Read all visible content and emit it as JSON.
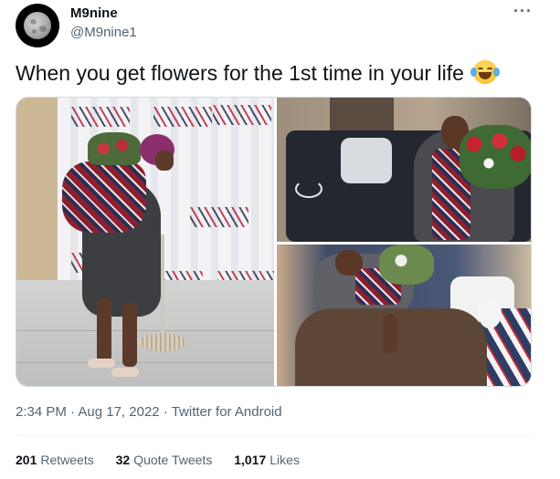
{
  "author": {
    "name": "M9nine",
    "handle": "@M9nine1",
    "avatar_icon": "moon-avatar-icon"
  },
  "more_label": "···",
  "tweet": {
    "text": "When you get flowers for the 1st time in your life",
    "emoji": "face-with-tears-of-joy-icon"
  },
  "media": {
    "count": 3
  },
  "meta": {
    "time": "2:34 PM",
    "separator1": " · ",
    "date": "Aug 17, 2022",
    "separator2": " · ",
    "client": "Twitter for Android"
  },
  "stats": {
    "retweets_count": "201",
    "retweets_label": "Retweets",
    "quotes_count": "32",
    "quotes_label": "Quote Tweets",
    "likes_count": "1,017",
    "likes_label": "Likes"
  },
  "colors": {
    "text_primary": "#0f1419",
    "text_secondary": "#536471",
    "divider": "#eff3f4",
    "border": "#cfd9de"
  }
}
